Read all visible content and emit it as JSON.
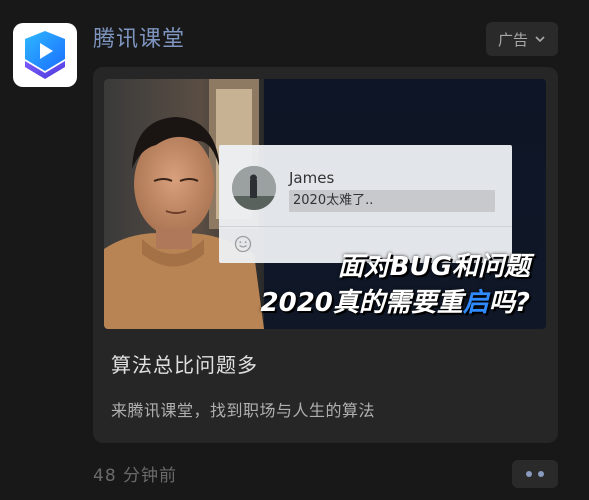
{
  "post": {
    "account_name": "腾讯课堂",
    "logo_icon": "tencent-classroom-logo-icon",
    "ad_label": "广告",
    "timestamp": "48 分钟前"
  },
  "card": {
    "title": "算法总比问题多",
    "description": "来腾讯课堂，找到职场与人生的算法"
  },
  "banner": {
    "chat_name": "James",
    "chat_input_text": "2020太难了..",
    "headline_line1": "面对BUG和问题",
    "headline_line2_before": "2020真的需要重",
    "headline_line2_highlight": "启",
    "headline_line2_after": "吗?"
  },
  "colors": {
    "background": "#181818",
    "card": "#262626",
    "account_name": "#7e95c0",
    "highlight_blue": "#2f8bff"
  }
}
